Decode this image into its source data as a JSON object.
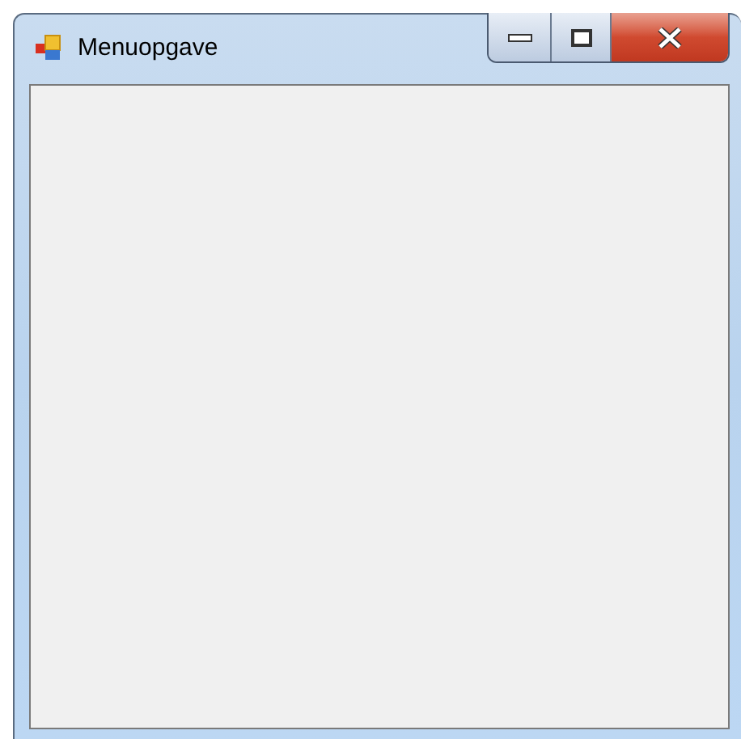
{
  "window": {
    "title": "Menuopgave"
  }
}
